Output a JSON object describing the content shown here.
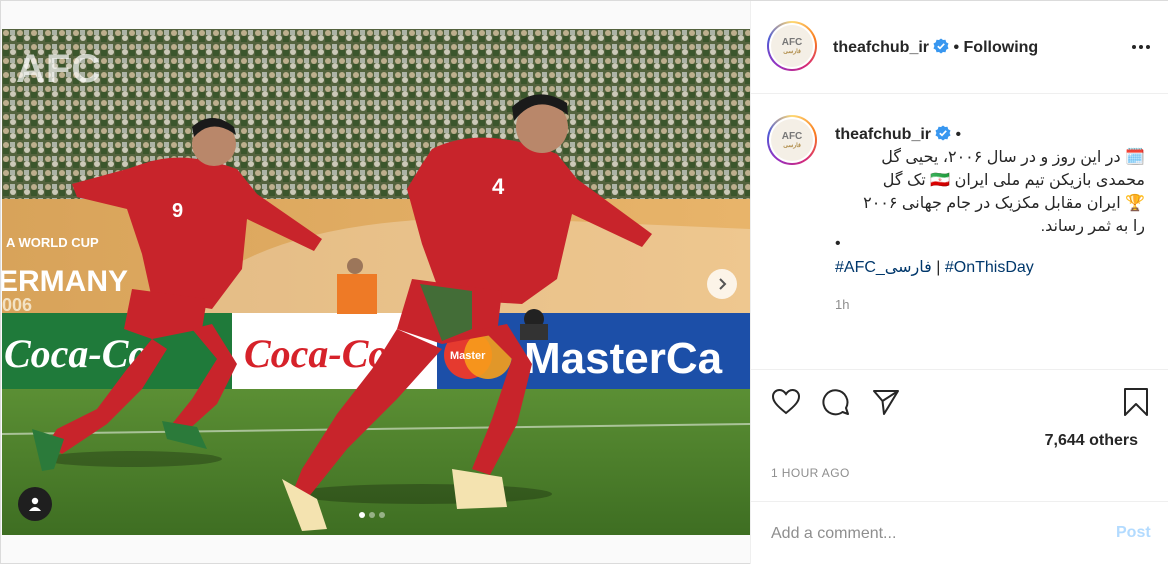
{
  "post": {
    "watermark": "AFC",
    "carousel": {
      "count": 3,
      "active_index": 0
    },
    "icons": {
      "next": "chevron-right-icon",
      "tag": "user-tag-icon"
    }
  },
  "header": {
    "username": "theafchub_ir",
    "separator": "•",
    "follow_label": "Following",
    "verified_color": "#3897f0",
    "avatar": {
      "text": "AFC",
      "sub": "فارسی"
    }
  },
  "caption": {
    "username": "theafchub_ir",
    "separator": "•",
    "text": "🗓️ در این روز و در سال ۲۰۰۶، یحیی گل\nمحمدی بازیکن تیم ملی ایران 🇮🇷 تک گل\n🏆 ایران مقابل مکزیک در جام جهانی ۲۰۰۶\nرا به ثمر رساند.",
    "dot": "•",
    "hashtag1": "#AFC_فارسی",
    "divider": " | ",
    "hashtag2": "#OnThisDay",
    "time": "1h"
  },
  "actions": {
    "icons": [
      "heart-icon",
      "comment-icon",
      "share-icon",
      "bookmark-icon"
    ],
    "likes": "7,644 others",
    "timestamp": "1 HOUR AGO"
  },
  "comment": {
    "placeholder": "Add a comment...",
    "post_label": "Post"
  },
  "colors": {
    "link": "#00376b",
    "post_disabled": "#b3dbff",
    "jersey": "#c8242b",
    "pitch": "#4a7a2a"
  }
}
